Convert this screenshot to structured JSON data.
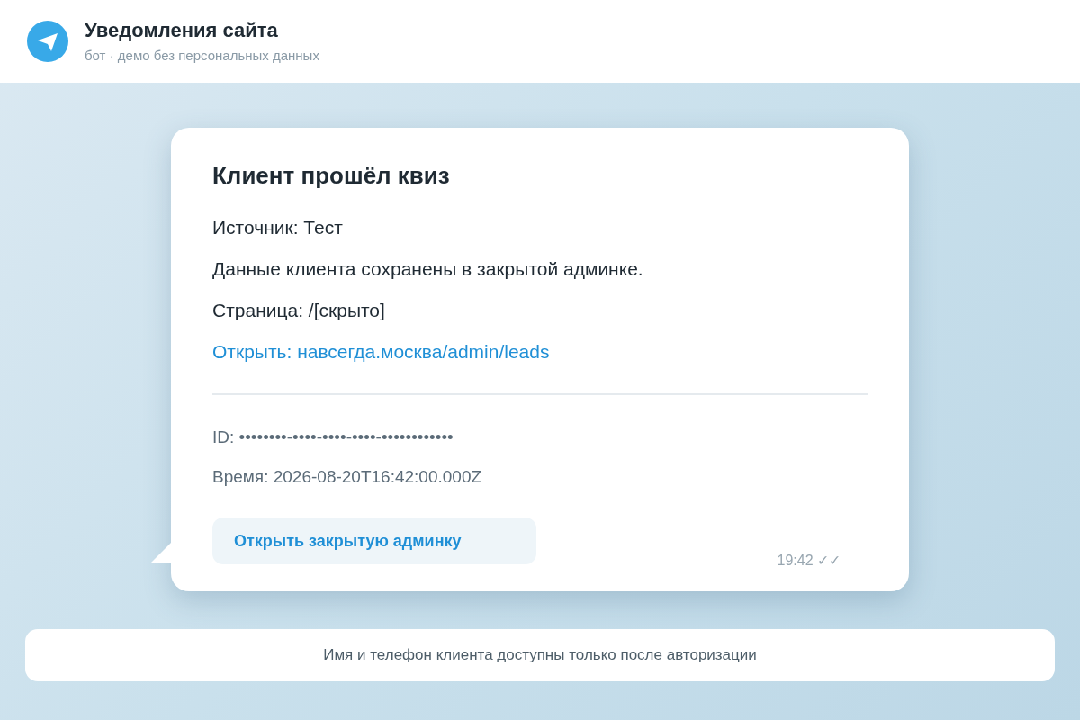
{
  "header": {
    "title": "Уведомления сайта",
    "subtitle": "бот · демо без персональных данных"
  },
  "message": {
    "title": "Клиент прошёл квиз",
    "lines": [
      {
        "kind": "text",
        "text": "Источник: Тест"
      },
      {
        "kind": "text",
        "text": "Данные клиента сохранены в закрытой админке."
      },
      {
        "kind": "text",
        "text": "Страница: /[скрыто]"
      },
      {
        "kind": "link",
        "text": "Открыть: навсегда.москва/admin/leads"
      }
    ],
    "meta": [
      "ID: ••••••••-••••-••••-••••-••••••••••••",
      "Время: 2026-08-20T16:42:00.000Z"
    ],
    "button": "Открыть закрытую админку",
    "time": "19:42 ✓✓"
  },
  "footer": "Имя и телефон клиента доступны только после авторизации"
}
